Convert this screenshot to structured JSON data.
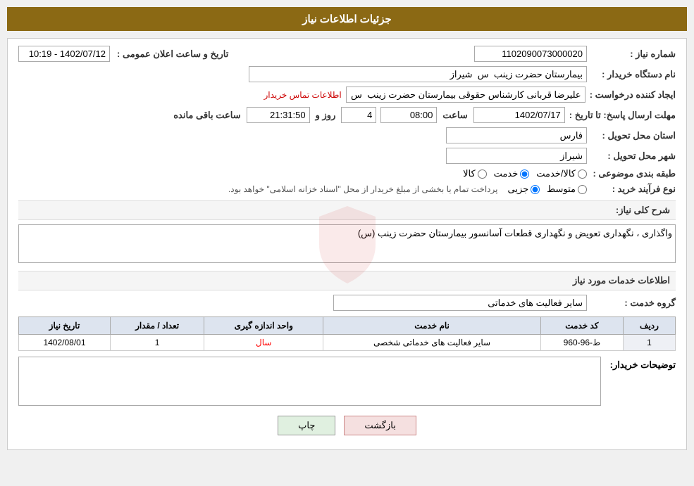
{
  "header": {
    "title": "جزئیات اطلاعات نیاز"
  },
  "fields": {
    "need_number_label": "شماره نیاز :",
    "need_number_value": "1102090073000020",
    "buyer_org_label": "نام دستگاه خریدار :",
    "buyer_org_value": "بیمارستان حضرت زینب  س  شیراز",
    "creator_label": "ایجاد کننده درخواست :",
    "creator_value": "علیرضا قربانی کارشناس حقوقی بیمارستان حضرت زینب  س  شیراز",
    "contact_link": "اطلاعات تماس خریدار",
    "deadline_label": "مهلت ارسال پاسخ: تا تاریخ :",
    "deadline_date": "1402/07/17",
    "deadline_time": "08:00",
    "deadline_days": "4",
    "deadline_remain_time": "21:31:50",
    "announcement_label": "تاریخ و ساعت اعلان عمومی :",
    "announcement_value": "1402/07/12 - 10:19",
    "province_label": "استان محل تحویل :",
    "province_value": "فارس",
    "city_label": "شهر محل تحویل :",
    "city_value": "شیراز",
    "category_label": "طبقه بندی موضوعی :",
    "radio_goods": "کالا",
    "radio_service": "خدمت",
    "radio_goods_service": "کالا/خدمت",
    "process_label": "نوع فرآیند خرید :",
    "radio_partial": "جزیی",
    "radio_medium": "متوسط",
    "process_note": "پرداخت تمام یا بخشی از مبلغ خریدار از محل \"اسناد خزانه اسلامی\" خواهد بود.",
    "need_desc_label": "شرح کلی نیاز:",
    "need_desc_value": "واگذاری ، نگهداری تعویض و نگهداری قطعات آسانسور بیمارستان حضرت زینب (س)",
    "service_info_label": "اطلاعات خدمات مورد نیاز",
    "service_group_label": "گروه خدمت :",
    "service_group_value": "سایر فعالیت های خدماتی",
    "table_headers": {
      "row_num": "ردیف",
      "service_code": "کد خدمت",
      "service_name": "نام خدمت",
      "unit": "واحد اندازه گیری",
      "quantity": "تعداد / مقدار",
      "date": "تاریخ نیاز"
    },
    "table_rows": [
      {
        "row_num": "1",
        "service_code": "ط-96-960",
        "service_name": "سایر فعالیت های خدماتی شخصی",
        "unit": "سال",
        "quantity": "1",
        "date": "1402/08/01"
      }
    ],
    "buyer_notes_label": "توضیحات خریدار:",
    "buyer_notes_value": "",
    "days_label": "روز و",
    "hours_label": "ساعت باقی مانده"
  },
  "buttons": {
    "back_label": "بازگشت",
    "print_label": "چاپ"
  }
}
